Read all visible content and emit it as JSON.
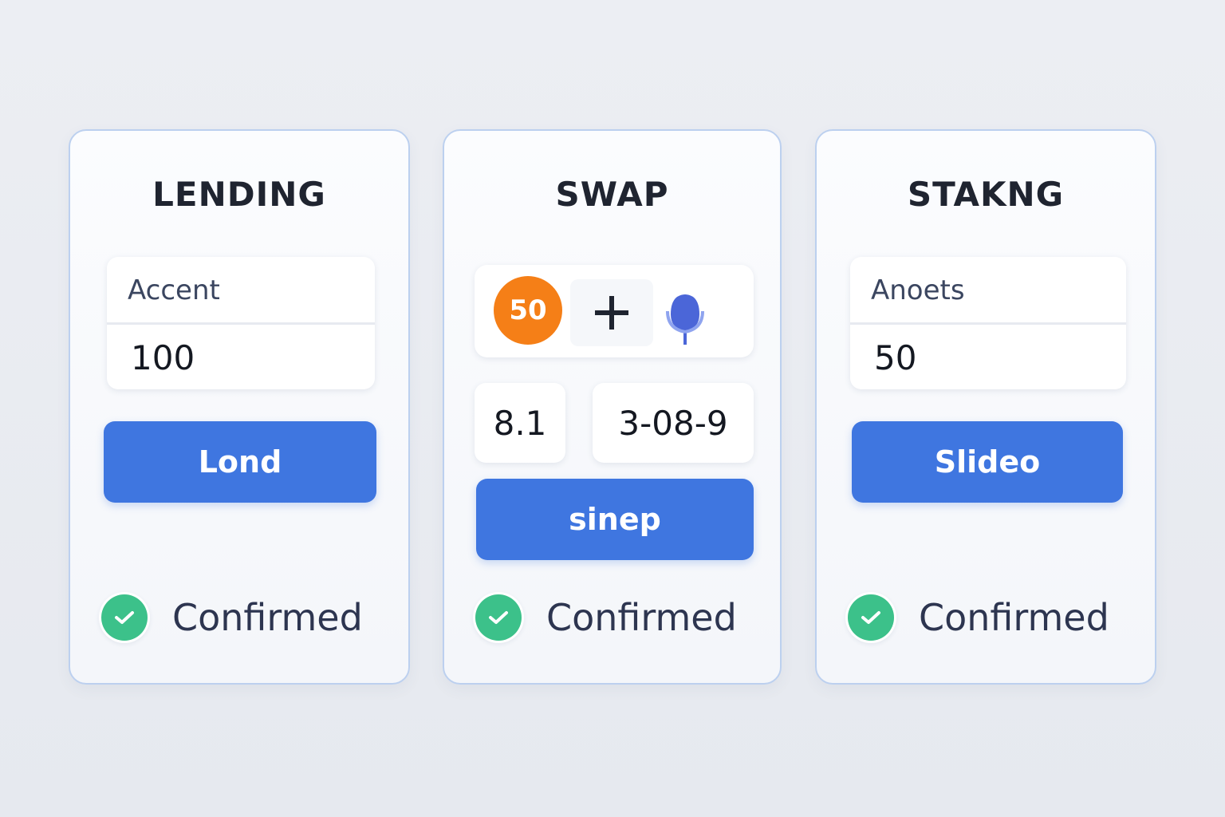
{
  "cards": {
    "lending": {
      "title": "LENDING",
      "field_label": "Accent",
      "field_value": "100",
      "button_label": "Lond",
      "status": "Confirmed"
    },
    "swap": {
      "title": "SWAP",
      "token_badge": "50",
      "plus_symbol": "+",
      "rate_value": "8.1",
      "amount_value": "3-08-9",
      "button_label": "sinep",
      "status": "Confirmed"
    },
    "staking": {
      "title": "STAKNG",
      "field_label": "Anoets",
      "field_value": "50",
      "button_label": "Slideo",
      "status": "Confirmed"
    }
  },
  "colors": {
    "accent_button": "#3f76e0",
    "success": "#3cc18a",
    "token_orange": "#f57f17",
    "card_border": "#bcd0ef"
  },
  "icons": {
    "status": "check-icon",
    "swap_add": "plus-icon",
    "swap_token_b": "microphone-icon"
  }
}
